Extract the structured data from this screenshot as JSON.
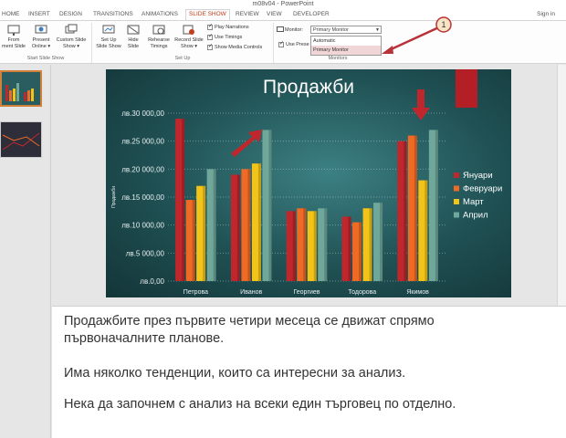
{
  "window": {
    "title": "m08v04 - PowerPoint"
  },
  "tabs": [
    {
      "label": "HOME",
      "active": false
    },
    {
      "label": "INSERT",
      "active": false
    },
    {
      "label": "DESIGN",
      "active": false
    },
    {
      "label": "TRANSITIONS",
      "active": false
    },
    {
      "label": "ANIMATIONS",
      "active": false
    },
    {
      "label": "SLIDE SHOW",
      "active": true
    },
    {
      "label": "REVIEW",
      "active": false
    },
    {
      "label": "VIEW",
      "active": false
    },
    {
      "label": "DEVELOPER",
      "active": false
    }
  ],
  "account": {
    "sign_in": "Sign in"
  },
  "ribbon": {
    "start": {
      "from_line1": "From",
      "from_line2": "ment Slide",
      "present_line1": "Present",
      "present_line2": "Online ▾",
      "custom_line1": "Custom Slide",
      "custom_line2": "Show ▾",
      "group": "Start Slide Show"
    },
    "setup": {
      "setup_line1": "Set Up",
      "setup_line2": "Slide Show",
      "hide_line1": "Hide",
      "hide_line2": "Slide",
      "rehearse_line1": "Rehearse",
      "rehearse_line2": "Timings",
      "record_line1": "Record Slide",
      "record_line2": "Show ▾",
      "play_narrations": "Play Narrations",
      "use_timings": "Use Timings",
      "show_media_controls": "Show Media Controls",
      "group": "Set Up"
    },
    "monitors": {
      "monitor_label": "Monitor:",
      "monitor_value": "Primary Monitor",
      "use_presenter": "Use Prese",
      "options": [
        "Automatic",
        "Primary Monitor"
      ],
      "group": "Monitors"
    }
  },
  "annotation": {
    "callout_number": "1"
  },
  "slide": {
    "title": "Продажби",
    "chart_data": {
      "type": "bar",
      "title": "Продажби",
      "ylabel": "Продажби",
      "categories": [
        "Петрова",
        "Иванов",
        "Георгиев",
        "Тодорова",
        "Якимов"
      ],
      "series": [
        {
          "name": "Януари",
          "color": "#c0272d",
          "values": [
            29000,
            19000,
            12500,
            11500,
            25000
          ]
        },
        {
          "name": "Февруари",
          "color": "#ef6a24",
          "values": [
            14500,
            20000,
            13000,
            10500,
            26000
          ]
        },
        {
          "name": "Март",
          "color": "#f2c318",
          "values": [
            17000,
            21000,
            12500,
            13000,
            18000
          ]
        },
        {
          "name": "Април",
          "color": "#6fa89a",
          "values": [
            20000,
            27000,
            13000,
            14000,
            27000
          ]
        }
      ],
      "yticks": [
        "лв.0,00",
        "лв.5 000,00",
        "лв.10 000,00",
        "лв.15 000,00",
        "лв.20 000,00",
        "лв.25 000,00",
        "лв.30 000,00"
      ],
      "ylim": [
        0,
        30000
      ],
      "grid": true,
      "legend": "right"
    }
  },
  "notes": {
    "line1": "Продажбите през първите четири месеца се движат спрямо",
    "line2": "първоначалните планове.",
    "line3": "Има няколко тенденции, които са интересни за анализ.",
    "line4": "Нека да започнем с анализ на всеки един търговец по отделно."
  }
}
